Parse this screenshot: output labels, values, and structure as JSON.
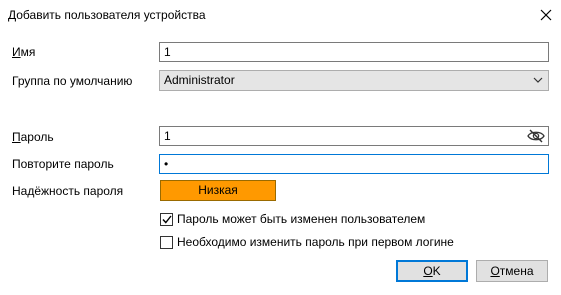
{
  "window": {
    "title": "Добавить пользователя устройства"
  },
  "form": {
    "name": {
      "label": "Имя",
      "value": "1"
    },
    "group": {
      "label": "Группа по умолчанию",
      "value": "Administrator"
    },
    "password": {
      "label": "Пароль",
      "value": "1"
    },
    "confirm": {
      "label": "Повторите пароль",
      "value": "•"
    },
    "strength": {
      "label": "Надёжность пароля",
      "value": "Низкая",
      "color": "#ff9900"
    },
    "options": [
      {
        "label": "Пароль может быть изменен пользователем",
        "checked": true
      },
      {
        "label": "Необходимо изменить пароль при первом логине",
        "checked": false
      }
    ]
  },
  "buttons": {
    "ok": "OK",
    "cancel": "Отмена"
  },
  "colors": {
    "accent": "#0078d7",
    "strength_weak": "#ff9900"
  },
  "icons": {
    "close": "close-icon",
    "dropdown": "chevron-down-icon",
    "reveal": "eye-slash-icon"
  }
}
